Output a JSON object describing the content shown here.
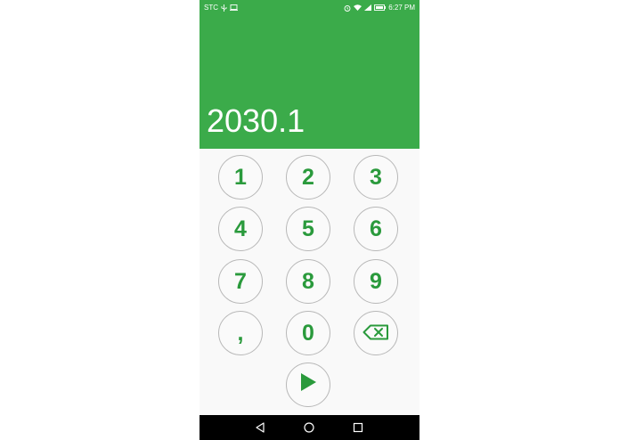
{
  "status_bar": {
    "carrier": "STC",
    "time": "6:27 PM",
    "icons_left": [
      "usb-icon",
      "screen-cast-icon"
    ],
    "icons_right": [
      "alarm-icon",
      "wifi-icon",
      "cell-signal-icon",
      "battery-icon"
    ]
  },
  "display": {
    "value": "2030.1"
  },
  "keypad": {
    "keys": [
      "1",
      "2",
      "3",
      "4",
      "5",
      "6",
      "7",
      "8",
      "9",
      ",",
      "0"
    ],
    "backspace_icon": "backspace-icon",
    "submit_icon": "play-icon"
  },
  "navigation": {
    "icons": [
      "back-icon",
      "home-icon",
      "recent-apps-icon"
    ]
  },
  "colors": {
    "header": "#3bab4a",
    "key_text": "#2a9a3c",
    "key_border": "#b8b8b8",
    "background": "#f9f9f9",
    "nav_bar": "#000000"
  }
}
